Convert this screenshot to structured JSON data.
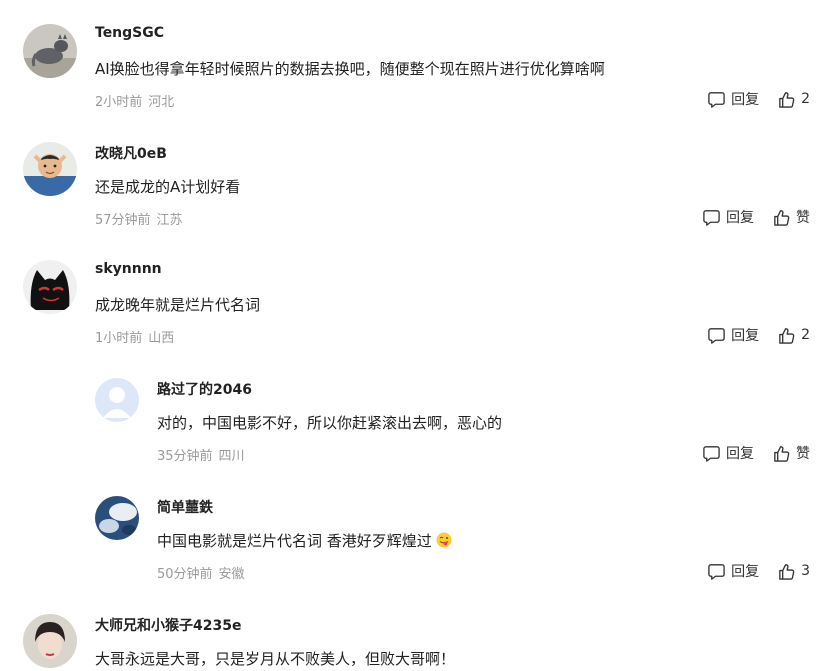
{
  "comments": [
    {
      "user": "TengSGC",
      "text": "AI换脸也得拿年轻时候照片的数据去换吧，随便整个现在照片进行优化算啥啊",
      "time": "2小时前",
      "location": "河北",
      "reply_label": "回复",
      "like_label": "2"
    },
    {
      "user": "改晓凡0eB",
      "text": "还是成龙的A计划好看",
      "time": "57分钟前",
      "location": "江苏",
      "reply_label": "回复",
      "like_label": "赞"
    },
    {
      "user": "skynnnn",
      "text": "成龙晚年就是烂片代名词",
      "time": "1小时前",
      "location": "山西",
      "reply_label": "回复",
      "like_label": "2"
    },
    {
      "user": "路过了的2046",
      "text": "对的，中国电影不好，所以你赶紧滚出去啊，恶心的",
      "time": "35分钟前",
      "location": "四川",
      "reply_label": "回复",
      "like_label": "赞"
    },
    {
      "user": "简单蘁鉄",
      "text": "中国电影就是烂片代名词 香港好歹辉煌过",
      "time": "50分钟前",
      "location": "安徽",
      "reply_label": "回复",
      "like_label": "3"
    },
    {
      "user": "大师兄和小猴子4235e",
      "text": "大哥永远是大哥，只是岁月从不败美人，但败大哥啊！"
    }
  ],
  "icons": {
    "reply": "comment-bubble-icon",
    "like": "thumbs-up-icon",
    "emoji": "winking-tongue-emoji"
  },
  "colors": {
    "text": "#222222",
    "meta": "#9a9a9a",
    "action": "#333333"
  }
}
